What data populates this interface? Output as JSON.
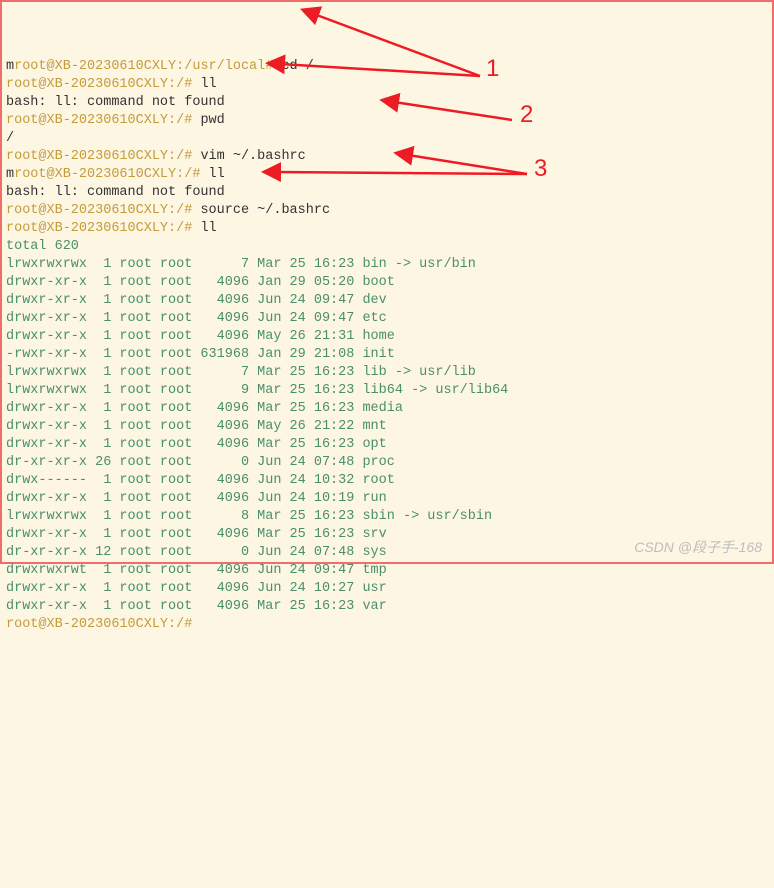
{
  "lines": [
    {
      "seg": [
        {
          "t": "m",
          "c": "cmd"
        },
        {
          "t": "root@XB-20230610CXLY:/usr/local#",
          "c": "prompt"
        },
        {
          "t": " cd /",
          "c": "cmd"
        }
      ]
    },
    {
      "seg": [
        {
          "t": "root@XB-20230610CXLY:/#",
          "c": "prompt"
        },
        {
          "t": " ll",
          "c": "cmd"
        }
      ]
    },
    {
      "seg": [
        {
          "t": "bash: ll: command not found",
          "c": "out-dark"
        }
      ]
    },
    {
      "seg": [
        {
          "t": "root@XB-20230610CXLY:/#",
          "c": "prompt"
        },
        {
          "t": " pwd",
          "c": "cmd"
        }
      ]
    },
    {
      "seg": [
        {
          "t": "/",
          "c": "out-dark"
        }
      ]
    },
    {
      "seg": [
        {
          "t": "root@XB-20230610CXLY:/#",
          "c": "prompt"
        },
        {
          "t": " vim ~/.bashrc",
          "c": "cmd"
        }
      ]
    },
    {
      "seg": [
        {
          "t": "m",
          "c": "cmd"
        },
        {
          "t": "root@XB-20230610CXLY:/#",
          "c": "prompt"
        },
        {
          "t": " ll",
          "c": "cmd"
        }
      ]
    },
    {
      "seg": [
        {
          "t": "bash: ll: command not found",
          "c": "out-dark"
        }
      ]
    },
    {
      "seg": [
        {
          "t": "root@XB-20230610CXLY:/#",
          "c": "prompt"
        },
        {
          "t": " source ~/.bashrc",
          "c": "cmd"
        }
      ]
    },
    {
      "seg": [
        {
          "t": "root@XB-20230610CXLY:/#",
          "c": "prompt"
        },
        {
          "t": " ll",
          "c": "cmd"
        }
      ]
    },
    {
      "seg": [
        {
          "t": "total 620",
          "c": "out"
        }
      ]
    },
    {
      "seg": [
        {
          "t": "lrwxrwxrwx  1 root root      7 Mar 25 16:23 bin -> usr/bin",
          "c": "out"
        }
      ]
    },
    {
      "seg": [
        {
          "t": "drwxr-xr-x  1 root root   4096 Jan 29 05:20 boot",
          "c": "out"
        }
      ]
    },
    {
      "seg": [
        {
          "t": "drwxr-xr-x  1 root root   4096 Jun 24 09:47 dev",
          "c": "out"
        }
      ]
    },
    {
      "seg": [
        {
          "t": "drwxr-xr-x  1 root root   4096 Jun 24 09:47 etc",
          "c": "out"
        }
      ]
    },
    {
      "seg": [
        {
          "t": "drwxr-xr-x  1 root root   4096 May 26 21:31 home",
          "c": "out"
        }
      ]
    },
    {
      "seg": [
        {
          "t": "-rwxr-xr-x  1 root root 631968 Jan 29 21:08 init",
          "c": "out"
        }
      ]
    },
    {
      "seg": [
        {
          "t": "lrwxrwxrwx  1 root root      7 Mar 25 16:23 lib -> usr/lib",
          "c": "out"
        }
      ]
    },
    {
      "seg": [
        {
          "t": "lrwxrwxrwx  1 root root      9 Mar 25 16:23 lib64 -> usr/lib64",
          "c": "out"
        }
      ]
    },
    {
      "seg": [
        {
          "t": "drwxr-xr-x  1 root root   4096 Mar 25 16:23 media",
          "c": "out"
        }
      ]
    },
    {
      "seg": [
        {
          "t": "drwxr-xr-x  1 root root   4096 May 26 21:22 mnt",
          "c": "out"
        }
      ]
    },
    {
      "seg": [
        {
          "t": "drwxr-xr-x  1 root root   4096 Mar 25 16:23 opt",
          "c": "out"
        }
      ]
    },
    {
      "seg": [
        {
          "t": "dr-xr-xr-x 26 root root      0 Jun 24 07:48 proc",
          "c": "out"
        }
      ]
    },
    {
      "seg": [
        {
          "t": "drwx------  1 root root   4096 Jun 24 10:32 root",
          "c": "out"
        }
      ]
    },
    {
      "seg": [
        {
          "t": "drwxr-xr-x  1 root root   4096 Jun 24 10:19 run",
          "c": "out"
        }
      ]
    },
    {
      "seg": [
        {
          "t": "lrwxrwxrwx  1 root root      8 Mar 25 16:23 sbin -> usr/sbin",
          "c": "out"
        }
      ]
    },
    {
      "seg": [
        {
          "t": "drwxr-xr-x  1 root root   4096 Mar 25 16:23 srv",
          "c": "out"
        }
      ]
    },
    {
      "seg": [
        {
          "t": "dr-xr-xr-x 12 root root      0 Jun 24 07:48 sys",
          "c": "out"
        }
      ]
    },
    {
      "seg": [
        {
          "t": "drwxrwxrwt  1 root root   4096 Jun 24 09:47 tmp",
          "c": "out"
        }
      ]
    },
    {
      "seg": [
        {
          "t": "drwxr-xr-x  1 root root   4096 Jun 24 10:27 usr",
          "c": "out"
        }
      ]
    },
    {
      "seg": [
        {
          "t": "drwxr-xr-x  1 root root   4096 Mar 25 16:23 var",
          "c": "out"
        }
      ]
    },
    {
      "seg": [
        {
          "t": "root@XB-20230610CXLY:/#",
          "c": "prompt"
        }
      ]
    }
  ],
  "annotations": {
    "one": "1",
    "two": "2",
    "three": "3"
  },
  "watermark": "CSDN @段子手-168"
}
